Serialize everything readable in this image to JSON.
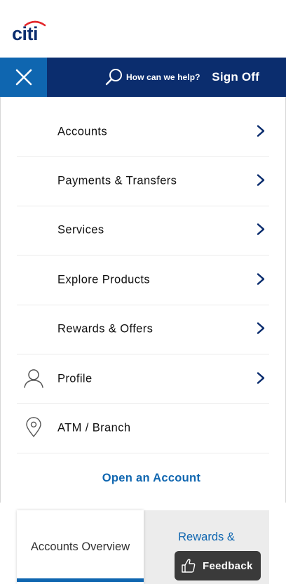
{
  "brand": {
    "logo_text": "citi",
    "logo_color": "#0b2d6e",
    "arc_color": "#e3262a"
  },
  "navbar": {
    "close_icon": "close-icon",
    "search_label": "How can we help?",
    "signoff_label": "Sign Off",
    "bg_color": "#0b2d6e",
    "close_bg_color": "#0f66b0"
  },
  "menu": {
    "items": [
      {
        "label": "Accounts",
        "has_chevron": true,
        "icon": ""
      },
      {
        "label": "Payments & Transfers",
        "has_chevron": true,
        "icon": ""
      },
      {
        "label": "Services",
        "has_chevron": true,
        "icon": ""
      },
      {
        "label": "Explore Products",
        "has_chevron": true,
        "icon": ""
      },
      {
        "label": "Rewards & Offers",
        "has_chevron": true,
        "icon": ""
      },
      {
        "label": "Profile",
        "has_chevron": true,
        "icon": "person-icon"
      },
      {
        "label": "ATM / Branch",
        "has_chevron": false,
        "icon": "location-pin-icon"
      }
    ],
    "open_account_label": "Open an Account"
  },
  "tabs": {
    "active_label": "Accounts Overview",
    "second_label": "Rewards &"
  },
  "feedback": {
    "label": "Feedback",
    "icon": "thumbs-up-icon"
  },
  "accent_color": "#0f66b0"
}
